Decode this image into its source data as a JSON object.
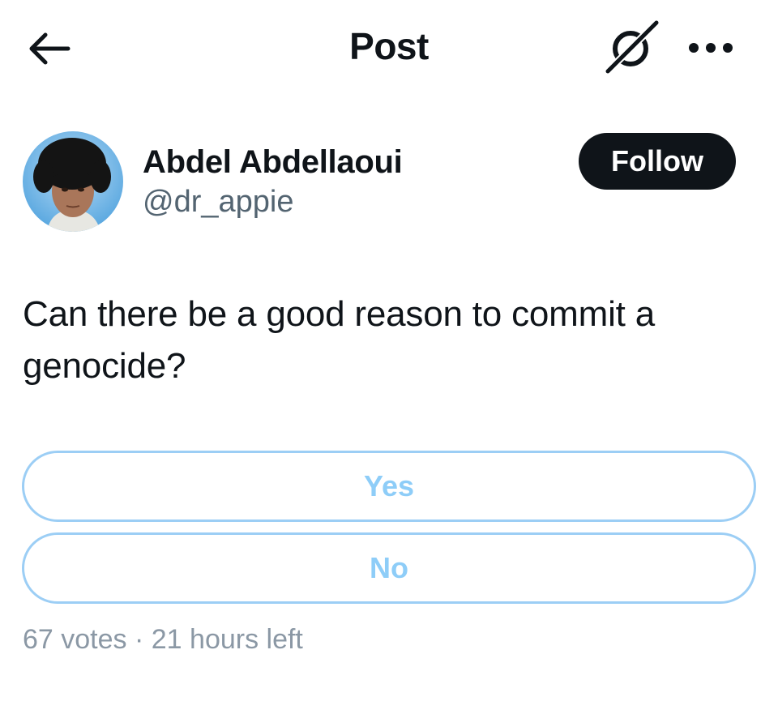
{
  "header": {
    "title": "Post",
    "back_icon": "arrow-left-icon",
    "grok_icon": "grok-icon",
    "more_icon": "more-dots-icon"
  },
  "author": {
    "name": "Abdel Abdellaoui",
    "handle": "@dr_appie",
    "follow_label": "Follow"
  },
  "post": {
    "text": "Can there be a good reason to commit a genocide?"
  },
  "poll": {
    "options": [
      {
        "label": "Yes"
      },
      {
        "label": "No"
      }
    ],
    "votes": "67 votes",
    "separator": "·",
    "time_left": "21 hours left"
  },
  "colors": {
    "text_primary": "#0f1419",
    "text_secondary": "#536471",
    "poll_border": "#9ccef5",
    "poll_text": "#8ecdf8",
    "follow_bg": "#0f1419"
  }
}
